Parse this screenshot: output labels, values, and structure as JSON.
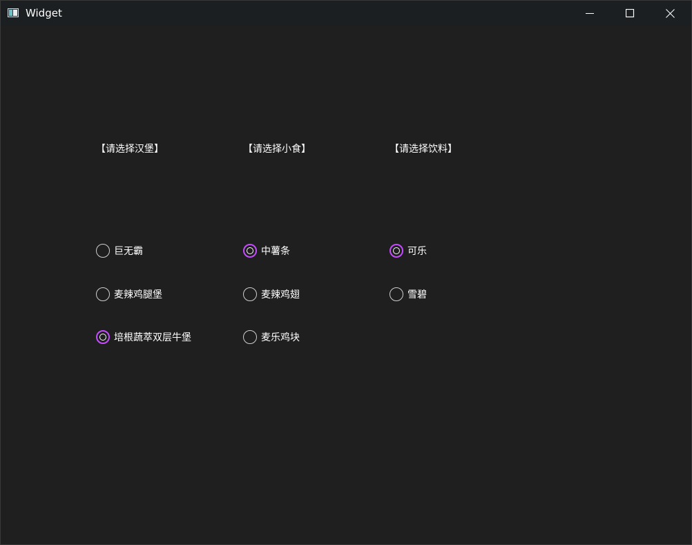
{
  "window": {
    "title": "Widget",
    "icon": "window-app-icon",
    "accent_color": "#c64bff",
    "background_color": "#1f1f1f"
  },
  "groups": [
    {
      "label": "【请选择汉堡】",
      "options": [
        {
          "label": "巨无霸",
          "checked": false
        },
        {
          "label": "麦辣鸡腿堡",
          "checked": false
        },
        {
          "label": "培根蔬萃双层牛堡",
          "checked": true
        }
      ]
    },
    {
      "label": "【请选择小食】",
      "options": [
        {
          "label": "中薯条",
          "checked": true
        },
        {
          "label": "麦辣鸡翅",
          "checked": false
        },
        {
          "label": "麦乐鸡块",
          "checked": false
        }
      ]
    },
    {
      "label": "【请选择饮料】",
      "options": [
        {
          "label": "可乐",
          "checked": true
        },
        {
          "label": "雪碧",
          "checked": false
        }
      ]
    }
  ]
}
